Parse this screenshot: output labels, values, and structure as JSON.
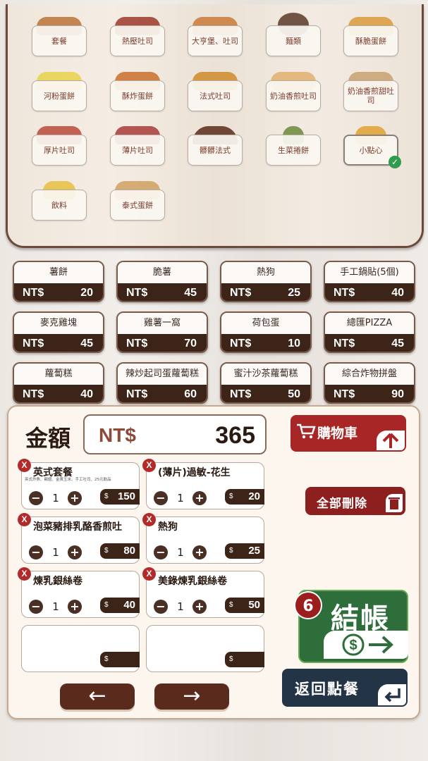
{
  "categories": [
    {
      "label": "套餐",
      "icon": "combo-meal-icon",
      "color": "#b8743a"
    },
    {
      "label": "熱壓吐司",
      "icon": "pressed-toast-icon",
      "color": "#9a3a2a"
    },
    {
      "label": "大亨堡、吐司",
      "icon": "hotdog-bun-icon",
      "color": "#c97a3a"
    },
    {
      "label": "麵類",
      "icon": "noodle-bowl-icon",
      "color": "#5a3a2a"
    },
    {
      "label": "酥脆蛋餅",
      "icon": "egg-roll-icon",
      "color": "#d99a3a"
    },
    {
      "label": "河粉蛋餅",
      "icon": "rice-noodle-icon",
      "color": "#e8d24a"
    },
    {
      "label": "酥炸蛋餅",
      "icon": "fried-roll-icon",
      "color": "#c9702a"
    },
    {
      "label": "法式吐司",
      "icon": "french-toast-icon",
      "color": "#d08a2a"
    },
    {
      "label": "奶油香煎吐司",
      "icon": "butter-toast-icon",
      "color": "#e0b070"
    },
    {
      "label": "奶油香煎甜吐司",
      "icon": "sweet-toast-icon",
      "color": "#c8a070"
    },
    {
      "label": "厚片吐司",
      "icon": "thick-toast-icon",
      "color": "#b84a3a"
    },
    {
      "label": "薄片吐司",
      "icon": "thin-toast-icon",
      "color": "#a83a3a"
    },
    {
      "label": "髒髒法式",
      "icon": "chocolate-toast-icon",
      "color": "#5a2a1a"
    },
    {
      "label": "生菜捲餅",
      "icon": "lettuce-wrap-icon",
      "color": "#6a8a3a"
    },
    {
      "label": "小點心",
      "icon": "fries-icon",
      "color": "#e0a030",
      "selected": true
    },
    {
      "label": "飲料",
      "icon": "drink-icon",
      "color": "#e8c040"
    },
    {
      "label": "泰式蛋餅",
      "icon": "thai-roll-icon",
      "color": "#d0a060"
    }
  ],
  "products": [
    {
      "name": "薯餅",
      "currency": "NT$",
      "price": "20"
    },
    {
      "name": "脆薯",
      "currency": "NT$",
      "price": "45"
    },
    {
      "name": "熱狗",
      "currency": "NT$",
      "price": "25"
    },
    {
      "name": "手工鍋貼(5個)",
      "currency": "NT$",
      "price": "40"
    },
    {
      "name": "麥克雞塊",
      "currency": "NT$",
      "price": "45"
    },
    {
      "name": "雞薯一窩",
      "currency": "NT$",
      "price": "70"
    },
    {
      "name": "荷包蛋",
      "currency": "NT$",
      "price": "10"
    },
    {
      "name": "總匯PIZZA",
      "currency": "NT$",
      "price": "45"
    },
    {
      "name": "蘿蔔糕",
      "currency": "NT$",
      "price": "40"
    },
    {
      "name": "辣炒起司蛋蘿蔔糕",
      "currency": "NT$",
      "price": "60"
    },
    {
      "name": "蜜汁沙茶蘿蔔糕",
      "currency": "NT$",
      "price": "50"
    },
    {
      "name": "綜合炸物拼盤",
      "currency": "NT$",
      "price": "90"
    }
  ],
  "cart": {
    "amount_label": "金額",
    "currency": "NT$",
    "total": "365",
    "price_symbol": "$",
    "items": [
      {
        "name": "英式套餐",
        "sub": "英式炸魚、鷄翅、金黃玉米、手工吐司、25元飲品",
        "qty": "1",
        "price": "150"
      },
      {
        "name": "(薄片)過敏-花生",
        "sub": "",
        "qty": "1",
        "price": "20"
      },
      {
        "name": "泡菜豬排乳酪香煎吐",
        "sub": "",
        "qty": "1",
        "price": "80"
      },
      {
        "name": "熱狗",
        "sub": "",
        "qty": "1",
        "price": "25"
      },
      {
        "name": "煉乳銀絲卷",
        "sub": "",
        "qty": "1",
        "price": "40"
      },
      {
        "name": "美錄煉乳銀絲卷",
        "sub": "",
        "qty": "1",
        "price": "50"
      }
    ],
    "minus_symbol": "−",
    "plus_symbol": "+",
    "delete_symbol": "X",
    "prev_arrow": "←",
    "next_arrow": "→"
  },
  "buttons": {
    "cart": "購物車",
    "clear_all": "全部刪除",
    "checkout": "結帳",
    "checkout_count": "6",
    "back_to_order": "返回點餐"
  },
  "colors": {
    "price_bar": "#3d2418",
    "cart_red": "#a82626",
    "checkout_green": "#2d6e3a",
    "back_navy": "#243447"
  }
}
